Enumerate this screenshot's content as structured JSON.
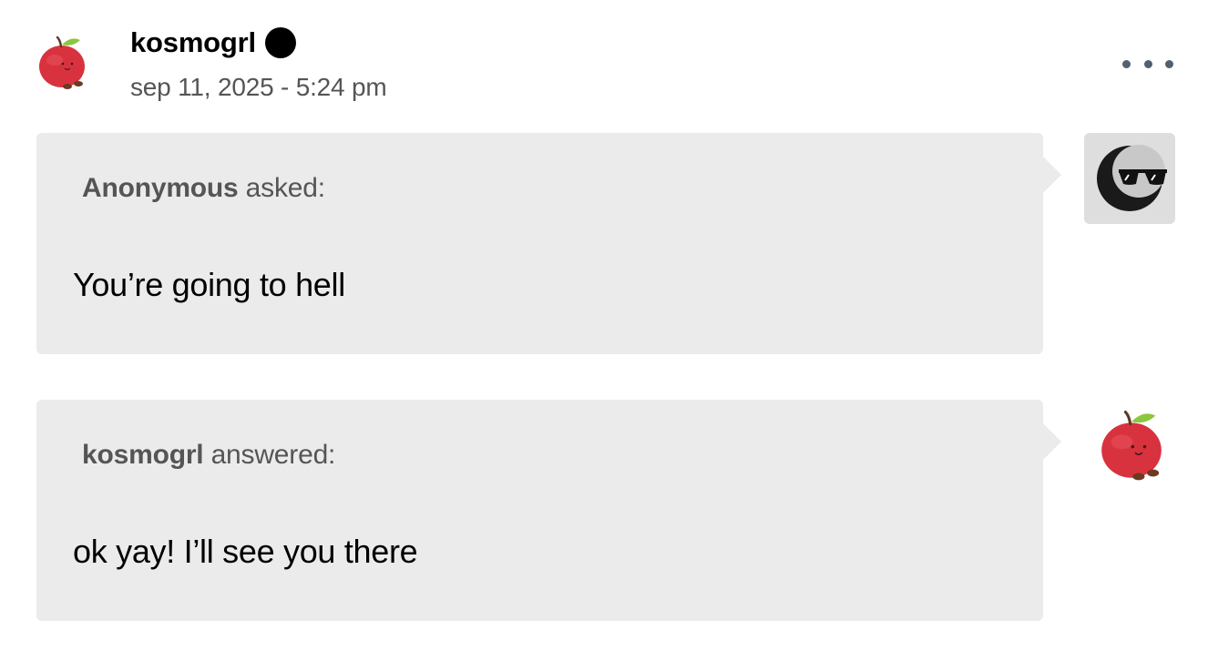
{
  "post": {
    "username": "kosmogrl",
    "timestamp": "sep 11, 2025 - 5:24 pm",
    "avatar_icon": "apple-plush-icon",
    "more_icon": "ellipsis-icon"
  },
  "ask": {
    "asker_name": "Anonymous",
    "asked_suffix": " asked:",
    "question": "You’re going to hell",
    "avatar_icon": "sunglasses-moon-icon"
  },
  "answer": {
    "answerer_name": "kosmogrl",
    "answered_suffix": " answered:",
    "text": "ok yay! I’ll see you there",
    "avatar_icon": "apple-plush-icon"
  },
  "colors": {
    "bubble_bg": "#ebebeb",
    "label_text": "#555555",
    "more_dots": "#526070",
    "apple_red": "#d9323f"
  }
}
